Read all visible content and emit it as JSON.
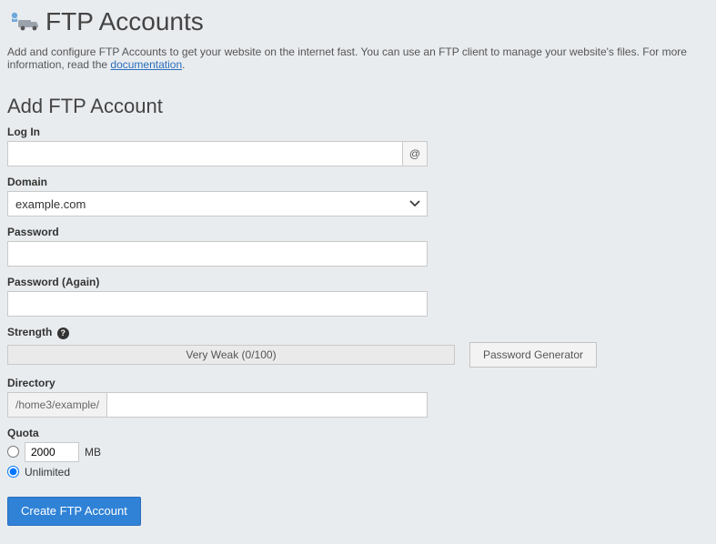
{
  "header": {
    "title": "FTP Accounts"
  },
  "intro": {
    "text_before_link": "Add and configure FTP Accounts to get your website on the internet fast. You can use an FTP client to manage your website's files. For more information, read the ",
    "link_text": "documentation",
    "text_after_link": "."
  },
  "form": {
    "heading": "Add FTP Account",
    "login": {
      "label": "Log In",
      "value": "",
      "addon": "@"
    },
    "domain": {
      "label": "Domain",
      "selected": "example.com"
    },
    "password": {
      "label": "Password",
      "value": ""
    },
    "password_again": {
      "label": "Password (Again)",
      "value": ""
    },
    "strength": {
      "label": "Strength",
      "meter_text": "Very Weak (0/100)",
      "generator_button": "Password Generator"
    },
    "directory": {
      "label": "Directory",
      "prefix": "/home3/example/",
      "value": ""
    },
    "quota": {
      "label": "Quota",
      "limited_value": "2000",
      "limited_unit": "MB",
      "unlimited_label": "Unlimited"
    },
    "submit_label": "Create FTP Account"
  }
}
